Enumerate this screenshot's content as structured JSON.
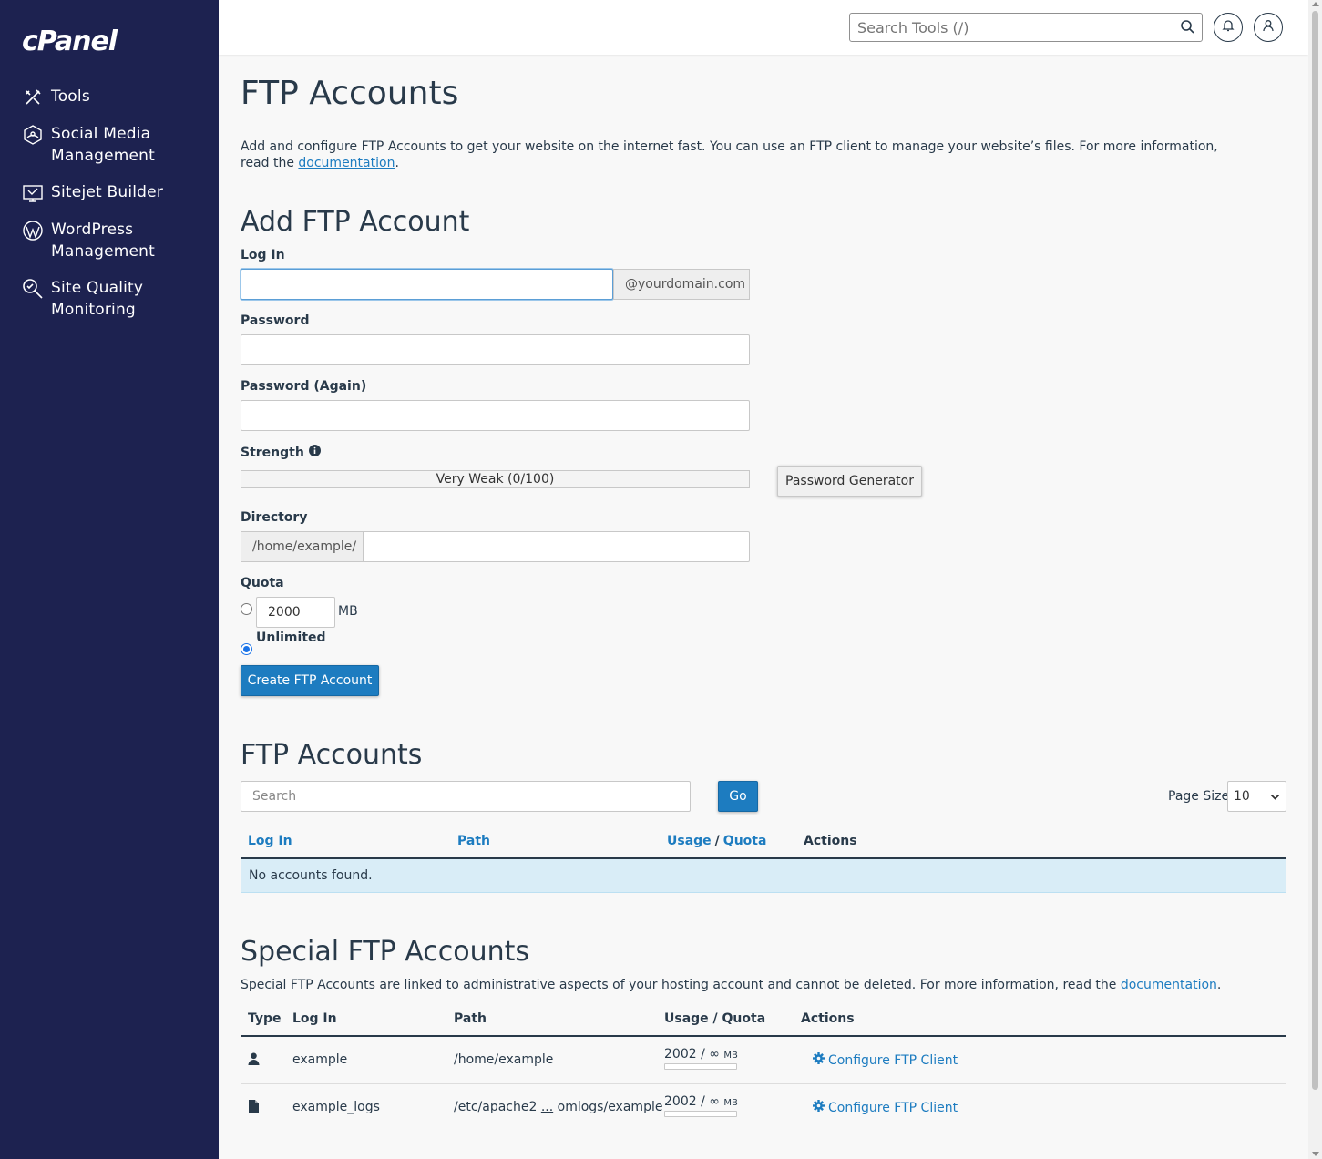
{
  "sidebar": {
    "logo": "cPanel",
    "items": [
      {
        "label": "Tools",
        "icon": "tools-icon"
      },
      {
        "label": "Social Media Management",
        "icon": "social-media-icon"
      },
      {
        "label": "Sitejet Builder",
        "icon": "sitejet-icon"
      },
      {
        "label": "WordPress Management",
        "icon": "wordpress-icon"
      },
      {
        "label": "Site Quality Monitoring",
        "icon": "site-quality-icon"
      }
    ]
  },
  "header": {
    "search_placeholder": "Search Tools (/)"
  },
  "page": {
    "title": "FTP Accounts",
    "intro_text": "Add and configure FTP Accounts to get your website on the internet fast. You can use an FTP client to manage your website’s files. For more information, read the",
    "intro_link": "documentation",
    "intro_end": "."
  },
  "add_form": {
    "heading": "Add FTP Account",
    "login_label": "Log In",
    "login_value": "",
    "domain_suffix": "@yourdomain.com",
    "password_label": "Password",
    "password_again_label": "Password (Again)",
    "strength_label": "Strength",
    "strength_text": "Very Weak (0/100)",
    "strength_value": 0,
    "password_generator_label": "Password Generator",
    "directory_label": "Directory",
    "directory_prefix": "/home/example/",
    "directory_value": "",
    "quota_label": "Quota",
    "quota_value": "2000",
    "quota_unit": "MB",
    "unlimited_label": "Unlimited",
    "quota_mode": "unlimited",
    "create_button_label": "Create FTP Account"
  },
  "accounts": {
    "heading": "FTP Accounts",
    "search_placeholder": "Search",
    "go_label": "Go",
    "page_size_label": "Page Size",
    "page_size_value": "10",
    "columns": {
      "login": "Log In",
      "path": "Path",
      "usage": "Usage",
      "slash": "/",
      "quota": "Quota",
      "actions": "Actions"
    },
    "empty_message": "No accounts found."
  },
  "special": {
    "heading": "Special FTP Accounts",
    "description": "Special FTP Accounts are linked to administrative aspects of your hosting account and cannot be deleted. For more information, read the",
    "description_link": "documentation",
    "description_end": ".",
    "columns": {
      "type": "Type",
      "login": "Log In",
      "path": "Path",
      "usage_quota": "Usage / Quota",
      "actions": "Actions"
    },
    "rows": [
      {
        "type_icon": "user-icon",
        "login": "example",
        "path": "/home/example",
        "path_ellipsis": "",
        "path_tail": "",
        "usage": "2002",
        "sep": " / ",
        "quota": "∞",
        "unit": "MB",
        "action": "Configure FTP Client"
      },
      {
        "type_icon": "file-icon",
        "login": "example_logs",
        "path": "/etc/apache2 ",
        "path_ellipsis": "...",
        "path_tail": " omlogs/example",
        "usage": "2002",
        "sep": " / ",
        "quota": "∞",
        "unit": "MB",
        "action": "Configure FTP Client"
      }
    ]
  },
  "colors": {
    "sidebar_bg": "#1d2250",
    "accent": "#1d7cc0",
    "info_row": "#d9edf7"
  }
}
